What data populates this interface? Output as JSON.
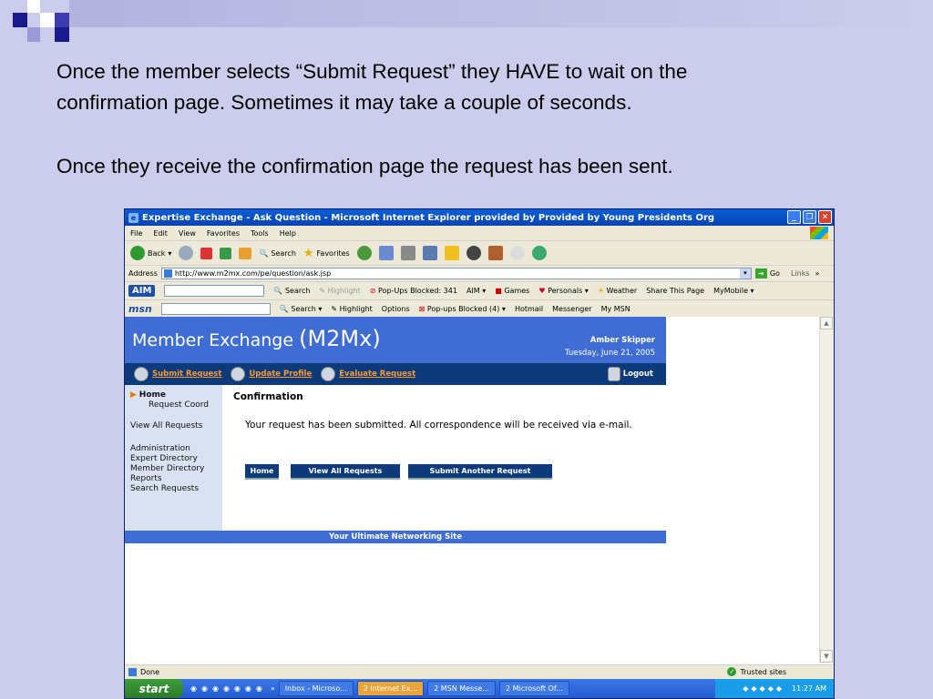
{
  "slide": {
    "line1": "Once the member selects “Submit Request” they HAVE to wait on the",
    "line2": "confirmation page.  Sometimes it may take a couple of seconds.",
    "line3": "Once they receive the confirmation page the request has been sent."
  },
  "browser": {
    "title": "Expertise Exchange - Ask Question - Microsoft Internet Explorer provided by Provided by Young Presidents Org",
    "menu": [
      "File",
      "Edit",
      "View",
      "Favorites",
      "Tools",
      "Help"
    ],
    "toolbar": {
      "back": "Back",
      "search": "Search",
      "favorites": "Favorites"
    },
    "address_label": "Address",
    "address_value": "http://www.m2mx.com/pe/question/ask.jsp",
    "go": "Go",
    "links": "Links",
    "aim_bar": {
      "logo": "AIM",
      "search": "Search",
      "highlight": "Highlight",
      "popups": "Pop-Ups Blocked: 341",
      "aim": "AIM",
      "games": "Games",
      "personals": "Personals",
      "weather": "Weather",
      "share": "Share This Page",
      "mymobile": "MyMobile"
    },
    "msn_bar": {
      "logo": "msn",
      "search": "Search",
      "highlight": "Highlight",
      "options": "Options",
      "popups": "Pop-ups Blocked (4)",
      "hotmail": "Hotmail",
      "messenger": "Messenger",
      "mymsn": "My MSN"
    },
    "status": "Done",
    "zone": "Trusted sites"
  },
  "site": {
    "title_main": "Member Exchange",
    "title_abbr": "(M2Mx)",
    "user": "Amber Skipper",
    "date": "Tuesday, June 21, 2005",
    "nav": [
      "Submit Request",
      "Update Profile",
      "Evaluate Request"
    ],
    "logout": "Logout",
    "left_nav": {
      "home": "Home",
      "request_coord": "Request Coord",
      "view_all": "View All Requests",
      "administration": "Administration",
      "expert_directory": "Expert Directory",
      "member_directory": "Member Directory",
      "reports": "Reports",
      "search_requests": "Search Requests"
    },
    "confirmation_title": "Confirmation",
    "confirmation_msg": "Your request has been submitted. All correspondence will be received via e-mail.",
    "buttons": {
      "home": "Home",
      "view_all": "View All Requests",
      "submit_another": "Submit Another Request"
    },
    "footer": "Your Ultimate Networking Site"
  },
  "taskbar": {
    "start": "start",
    "tasks": [
      "Inbox - Microso...",
      "2 Internet Ex...",
      "2 MSN Messe...",
      "2 Microsoft Of..."
    ],
    "time": "11:27 AM"
  }
}
